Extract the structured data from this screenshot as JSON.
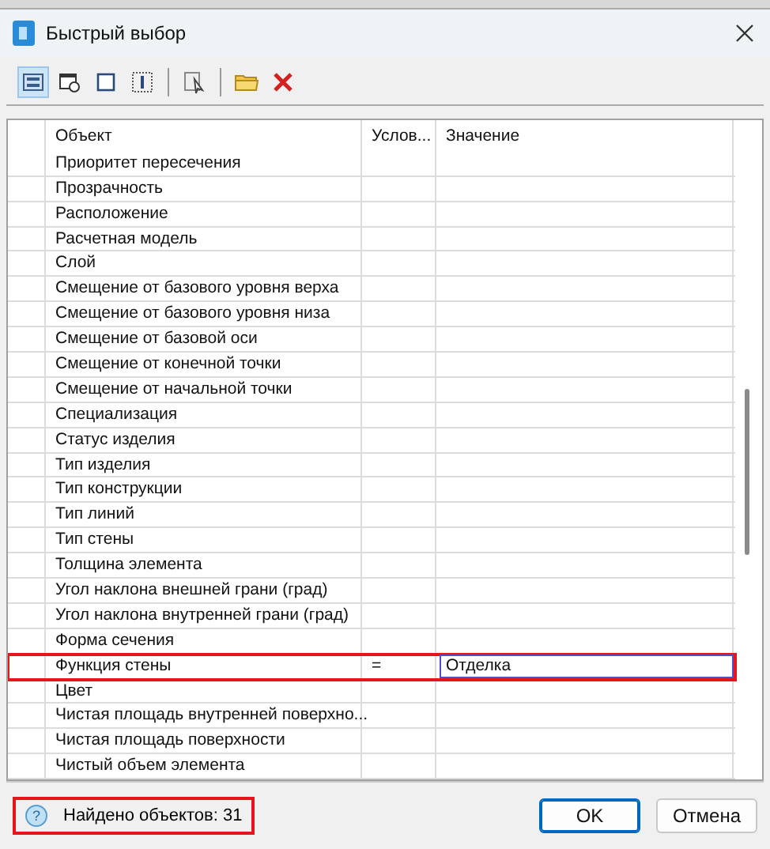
{
  "window": {
    "title": "Быстрый выбор"
  },
  "toolbar": [
    {
      "kind": "button",
      "selected": true
    },
    {
      "kind": "button",
      "selected": false
    },
    {
      "kind": "button",
      "selected": false
    },
    {
      "kind": "button",
      "selected": false
    },
    {
      "kind": "separator"
    },
    {
      "kind": "button",
      "selected": false
    },
    {
      "kind": "separator"
    },
    {
      "kind": "button",
      "selected": false
    },
    {
      "kind": "button",
      "selected": false
    }
  ],
  "table": {
    "columns": [
      "Объект",
      "Услов...",
      "Значение"
    ],
    "rows": [
      {
        "object": "Приоритет пересечения",
        "editing": false,
        "annotated": false
      },
      {
        "object": "Прозрачность",
        "editing": false,
        "annotated": false
      },
      {
        "object": "Расположение",
        "editing": false,
        "annotated": false
      },
      {
        "object": "Расчетная модель",
        "editing": false,
        "annotated": false
      },
      {
        "object": "Слой",
        "editing": false,
        "annotated": false
      },
      {
        "object": "Смещение от базового уровня верха",
        "editing": false,
        "annotated": false
      },
      {
        "object": "Смещение от базового уровня низа",
        "editing": false,
        "annotated": false
      },
      {
        "object": "Смещение от базовой оси",
        "editing": false,
        "annotated": false
      },
      {
        "object": "Смещение от конечной точки",
        "editing": false,
        "annotated": false
      },
      {
        "object": "Смещение от начальной точки",
        "editing": false,
        "annotated": false
      },
      {
        "object": "Специализация",
        "editing": false,
        "annotated": false
      },
      {
        "object": "Статус изделия",
        "editing": false,
        "annotated": false
      },
      {
        "object": "Тип изделия",
        "editing": false,
        "annotated": false
      },
      {
        "object": "Тип конструкции",
        "editing": false,
        "annotated": false
      },
      {
        "object": "Тип линий",
        "editing": false,
        "annotated": false
      },
      {
        "object": "Тип стены",
        "editing": false,
        "annotated": false
      },
      {
        "object": "Толщина элемента",
        "editing": false,
        "annotated": false
      },
      {
        "object": "Угол наклона внешней грани (град)",
        "editing": false,
        "annotated": false
      },
      {
        "object": "Угол наклона внутренней грани (град)",
        "editing": false,
        "annotated": false
      },
      {
        "object": "Форма сечения",
        "editing": false,
        "annotated": false
      },
      {
        "object": "Функция стены",
        "condition": "=",
        "value": "Отделка",
        "editing": true,
        "annotated": true
      },
      {
        "object": "Цвет",
        "editing": false,
        "annotated": false
      },
      {
        "object": "Чистая площадь  внутренней поверхно...",
        "editing": false,
        "annotated": false
      },
      {
        "object": "Чистая площадь поверхности",
        "editing": false,
        "annotated": false
      },
      {
        "object": "Чистый объем элемента",
        "editing": false,
        "annotated": false
      }
    ]
  },
  "status": {
    "help_icon": "?",
    "text": "Найдено объектов: 31",
    "annotated": true
  },
  "buttons": [
    {
      "label": "OK",
      "default": true
    },
    {
      "label": "Отмена",
      "default": false
    }
  ]
}
